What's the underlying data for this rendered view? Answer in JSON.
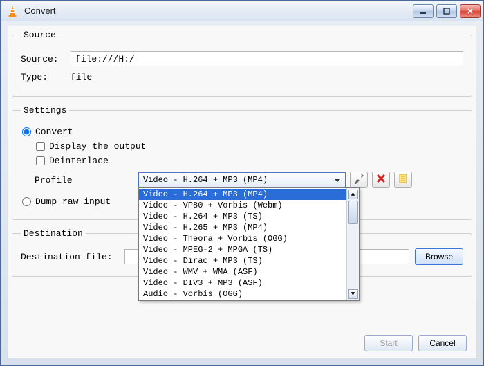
{
  "window": {
    "title": "Convert"
  },
  "source_group": {
    "legend": "Source",
    "source_label": "Source:",
    "source_value": "file:///H:/",
    "type_label": "Type:",
    "type_value": "file"
  },
  "settings_group": {
    "legend": "Settings",
    "convert_label": "Convert",
    "display_output_label": "Display the output",
    "deinterlace_label": "Deinterlace",
    "profile_label": "Profile",
    "profile_selected": "Video - H.264 + MP3 (MP4)",
    "profile_options": [
      "Video - H.264 + MP3 (MP4)",
      "Video - VP80 + Vorbis (Webm)",
      "Video - H.264 + MP3 (TS)",
      "Video - H.265 + MP3 (MP4)",
      "Video - Theora + Vorbis (OGG)",
      "Video - MPEG-2 + MPGA (TS)",
      "Video - Dirac + MP3 (TS)",
      "Video - WMV + WMA (ASF)",
      "Video - DIV3 + MP3 (ASF)",
      "Audio - Vorbis (OGG)"
    ],
    "dump_raw_label": "Dump raw input"
  },
  "icons": {
    "edit": "edit-profile-icon",
    "delete": "delete-profile-icon",
    "new": "new-profile-icon"
  },
  "destination_group": {
    "legend": "Destination",
    "file_label": "Destination file:",
    "file_value": "",
    "browse_label": "Browse"
  },
  "footer": {
    "start_label": "Start",
    "cancel_label": "Cancel"
  }
}
